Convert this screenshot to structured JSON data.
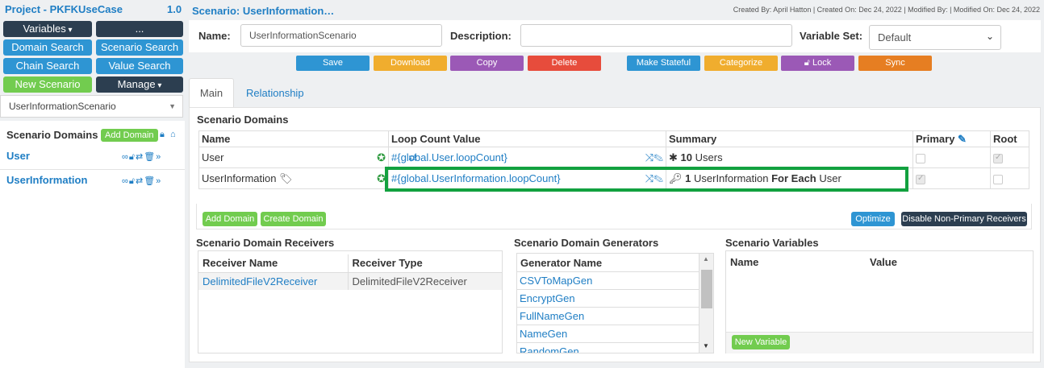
{
  "sidebar": {
    "project_title": "Project - PKFKUseCase",
    "project_version": "1.0",
    "buttons": {
      "variables": "Variables",
      "dots": "...",
      "domain_search": "Domain Search",
      "scenario_search": "Scenario Search",
      "chain_search": "Chain Search",
      "value_search": "Value Search",
      "new_scenario": "New Scenario",
      "manage": "Manage"
    },
    "scenario_select": "UserInformationScenario",
    "scenario_domains_title": "Scenario Domains",
    "add_domain": "Add Domain",
    "items": [
      {
        "label": "User"
      },
      {
        "label": "UserInformation"
      }
    ]
  },
  "header": {
    "title": "Scenario: UserInformation…",
    "meta": "Created By: April Hatton | Created On: Dec 24, 2022 | Modified By: | Modified On: Dec 24, 2022"
  },
  "form": {
    "name_label": "Name:",
    "name_value": "UserInformationScenario",
    "description_label": "Description:",
    "description_value": "",
    "variable_set_label": "Variable Set:",
    "variable_set_value": "Default"
  },
  "actions": {
    "save": "Save",
    "download": "Download",
    "copy": "Copy",
    "delete": "Delete",
    "make_stateful": "Make Stateful",
    "categorize": "Categorize",
    "lock": "Lock",
    "sync": "Sync"
  },
  "tabs": {
    "main": "Main",
    "relationship": "Relationship"
  },
  "domains_table": {
    "title": "Scenario Domains",
    "headers": {
      "name": "Name",
      "loop": "Loop Count Value",
      "summary": "Summary",
      "primary": "Primary",
      "root": "Root"
    },
    "rows": [
      {
        "name": "User",
        "loop": "#{global.User.loopCount}",
        "summary_count": "10",
        "summary_text": "Users",
        "primary": false,
        "root": true
      },
      {
        "name": "UserInformation",
        "loop": "#{global.UserInformation.loopCount}",
        "summary_count": "1",
        "summary_mid": "UserInformation",
        "summary_bold": "For Each",
        "summary_end": "User",
        "primary": true,
        "root": false
      }
    ],
    "add_domain": "Add Domain",
    "create_domain": "Create Domain",
    "optimize": "Optimize",
    "disable_non_primary": "Disable Non-Primary Receivers"
  },
  "receivers": {
    "title": "Scenario Domain Receivers",
    "headers": {
      "name": "Receiver Name",
      "type": "Receiver Type"
    },
    "rows": [
      {
        "name": "DelimitedFileV2Receiver",
        "type": "DelimitedFileV2Receiver"
      }
    ]
  },
  "generators": {
    "title": "Scenario Domain Generators",
    "header": "Generator Name",
    "items": [
      "CSVToMapGen",
      "EncryptGen",
      "FullNameGen",
      "NameGen",
      "RandomGen"
    ]
  },
  "variables": {
    "title": "Scenario Variables",
    "headers": {
      "name": "Name",
      "value": "Value"
    },
    "new_variable": "New Variable"
  },
  "colors": {
    "accent": "#1f7ec4",
    "dark": "#2c3e50",
    "blue": "#2e95d3",
    "green": "#72cc4f",
    "orange": "#f0ad2e",
    "purple": "#9b59b6",
    "red": "#e74c3c",
    "highlight": "#12a13f"
  }
}
